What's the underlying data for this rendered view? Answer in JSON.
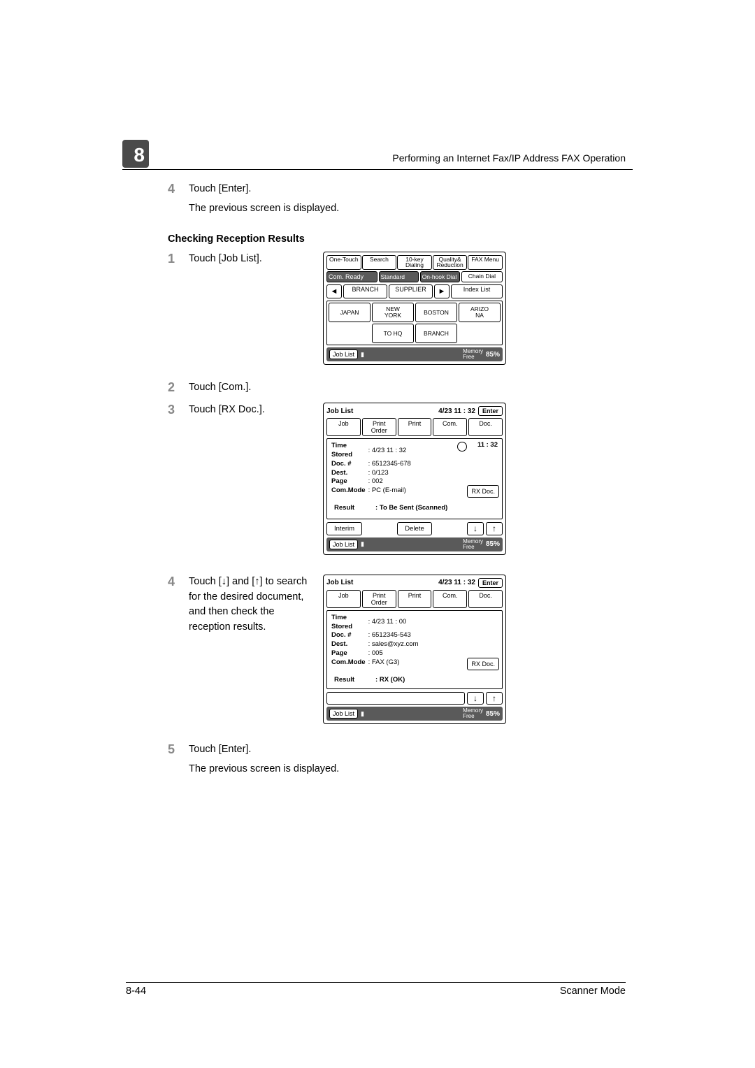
{
  "chapter_number": "8",
  "running_head": "Performing an Internet Fax/IP Address FAX Operation",
  "step4a": {
    "num": "4",
    "l1": "Touch [Enter].",
    "l2": "The previous screen is displayed."
  },
  "subhead": "Checking Reception Results",
  "step1": {
    "num": "1",
    "text": "Touch [Job List]."
  },
  "panel1": {
    "tabs": [
      "One-Touch",
      "Search",
      "10-key\nDialing",
      "Quality&\nReduction",
      "FAX Menu"
    ],
    "status_ready": "Com. Ready",
    "status_standard": "Standard",
    "status_onhook": "On-hook Dial",
    "status_chain": "Chain Dial",
    "index_branch": "BRANCH",
    "index_supplier": "SUPPLIER",
    "index_list": "Index List",
    "dest": [
      "JAPAN",
      "NEW\nYORK",
      "BOSTON",
      "ARIZO\nNA",
      "",
      "TO HQ",
      "BRANCH",
      ""
    ],
    "joblist": "Job List",
    "mem": "Memory\nFree",
    "pct": "85%"
  },
  "step2": {
    "num": "2",
    "text": "Touch [Com.]."
  },
  "step3": {
    "num": "3",
    "text": "Touch [RX Doc.]."
  },
  "panel2": {
    "title": "Job List",
    "datetime": "4/23 11 : 32",
    "enter": "Enter",
    "tabs": [
      "Job",
      "Print\nOrder",
      "Print",
      "Com.",
      "Doc."
    ],
    "labels": {
      "time": "Time\nStored",
      "doc": "Doc. #",
      "dest": "Dest.",
      "page": "Page",
      "mode": "Com.Mode",
      "result": "Result"
    },
    "vals": {
      "time": ": 4/23  11 : 32",
      "doc": ": 6512345-678",
      "dest": ":  0/123",
      "page": ": 002",
      "mode": ": PC (E-mail)",
      "result": ": To Be Sent (Scanned)"
    },
    "clock_time": "11 : 32",
    "rxdoc": "RX Doc.",
    "interim": "Interim",
    "delete": "Delete",
    "joblist": "Job List",
    "mem": "Memory\nFree",
    "pct": "85%"
  },
  "step4b": {
    "num": "4",
    "text": "Touch [↓] and [↑] to search for the desired document, and then check the reception results."
  },
  "panel3": {
    "title": "Job List",
    "datetime": "4/23 11 : 32",
    "enter": "Enter",
    "tabs": [
      "Job",
      "Print\nOrder",
      "Print",
      "Com.",
      "Doc."
    ],
    "labels": {
      "time": "Time\nStored",
      "doc": "Doc. #",
      "dest": "Dest.",
      "page": "Page",
      "mode": "Com.Mode",
      "result": "Result"
    },
    "vals": {
      "time": ": 4/23  11 : 00",
      "doc": ": 6512345-543",
      "dest": ": sales@xyz.com",
      "page": ": 005",
      "mode": ": FAX (G3)",
      "result": ": RX (OK)"
    },
    "rxdoc": "RX Doc.",
    "joblist": "Job List",
    "mem": "Memory\nFree",
    "pct": "85%"
  },
  "step5": {
    "num": "5",
    "l1": "Touch [Enter].",
    "l2": "The previous screen is displayed."
  },
  "footer_left": "8-44",
  "footer_right": "Scanner Mode"
}
